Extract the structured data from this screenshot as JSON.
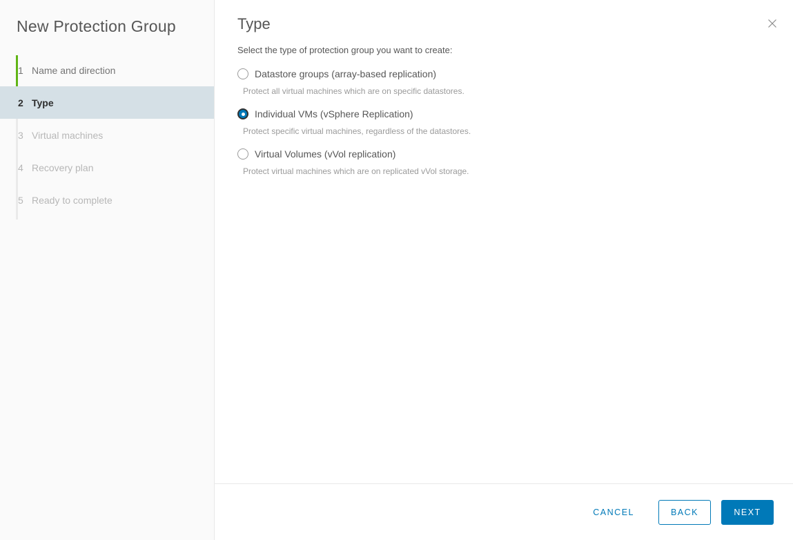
{
  "wizard": {
    "title": "New Protection Group",
    "close_icon": "close-icon",
    "steps": [
      {
        "number": "1",
        "label": "Name and direction",
        "state": "complete"
      },
      {
        "number": "2",
        "label": "Type",
        "state": "current"
      },
      {
        "number": "3",
        "label": "Virtual machines",
        "state": "disabled"
      },
      {
        "number": "4",
        "label": "Recovery plan",
        "state": "disabled"
      },
      {
        "number": "5",
        "label": "Ready to complete",
        "state": "disabled"
      }
    ]
  },
  "page": {
    "heading": "Type",
    "instruction": "Select the type of protection group you want to create:",
    "options": [
      {
        "label": "Datastore groups (array-based replication)",
        "description": "Protect all virtual machines which are on specific datastores.",
        "selected": false
      },
      {
        "label": "Individual VMs (vSphere Replication)",
        "description": "Protect specific virtual machines, regardless of the datastores.",
        "selected": true
      },
      {
        "label": "Virtual Volumes (vVol replication)",
        "description": "Protect virtual machines which are on replicated vVol storage.",
        "selected": false
      }
    ]
  },
  "footer": {
    "cancel_label": "CANCEL",
    "back_label": "BACK",
    "next_label": "NEXT"
  },
  "colors": {
    "accent": "#0079b8",
    "step_complete_bar": "#60b515",
    "step_current_bg": "#d5e0e6",
    "sidebar_bg": "#fafafa",
    "text_primary": "#565656",
    "text_muted": "#9a9a9a",
    "text_disabled": "#b7b7b7",
    "border": "#e8e8e8"
  }
}
